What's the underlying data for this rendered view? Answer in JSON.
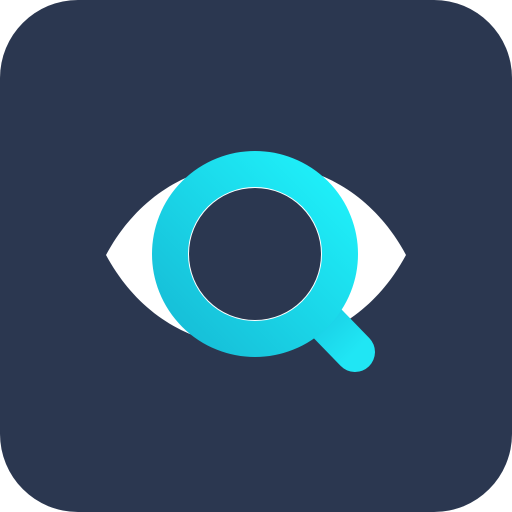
{
  "app_icon": {
    "icon": "eye-magnifier-icon",
    "colors": {
      "background": "#2b3750",
      "eye": "#ffffff",
      "lens_ring_start": "#16bcd6",
      "lens_ring_end": "#1ff2fb",
      "lens_center": "#2b3750"
    }
  }
}
